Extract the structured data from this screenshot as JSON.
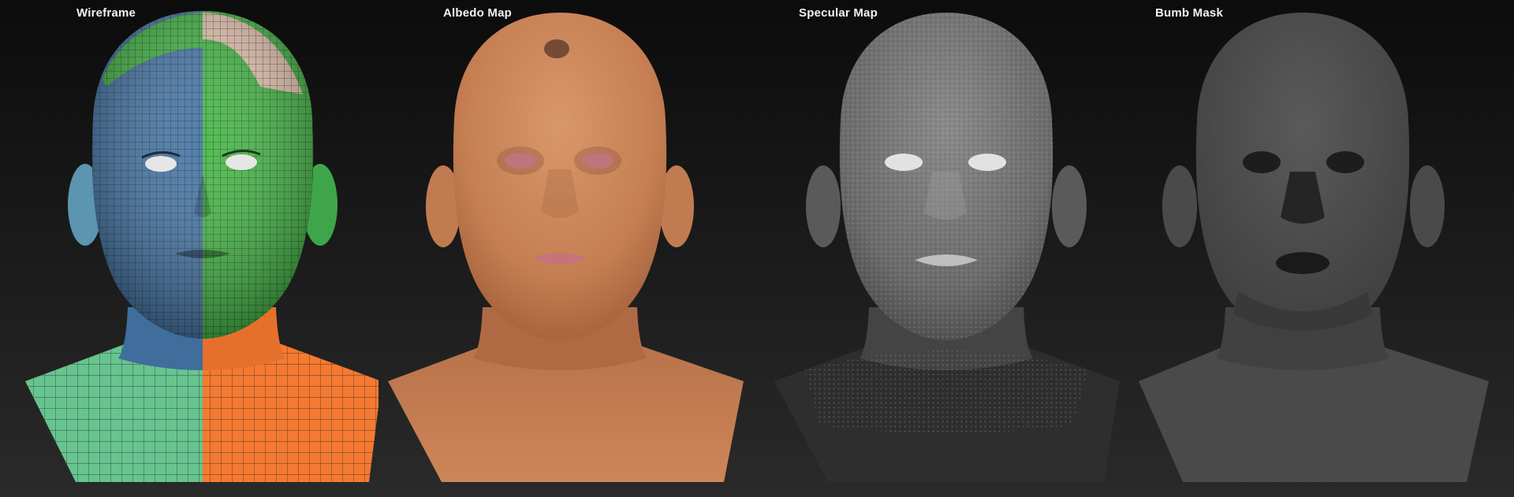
{
  "panels": [
    {
      "title": "Wireframe",
      "icon": "wireframe-head-icon"
    },
    {
      "title": "Albedo Map",
      "icon": "albedo-head-icon"
    },
    {
      "title": "Specular Map",
      "icon": "specular-head-icon"
    },
    {
      "title": "Bumb Mask",
      "icon": "bump-head-icon"
    }
  ],
  "colors": {
    "background_top": "#0c0c0c",
    "background_bottom": "#2a2a2a",
    "wire_blue": "#4a78a8",
    "wire_green": "#49b84a",
    "wire_pink": "#e8c6b4",
    "wire_mint": "#67c48f",
    "wire_orange": "#f47a32",
    "albedo_skin": "#c98356",
    "specular_gray": "#707070",
    "bump_gray": "#4e4e4e"
  }
}
